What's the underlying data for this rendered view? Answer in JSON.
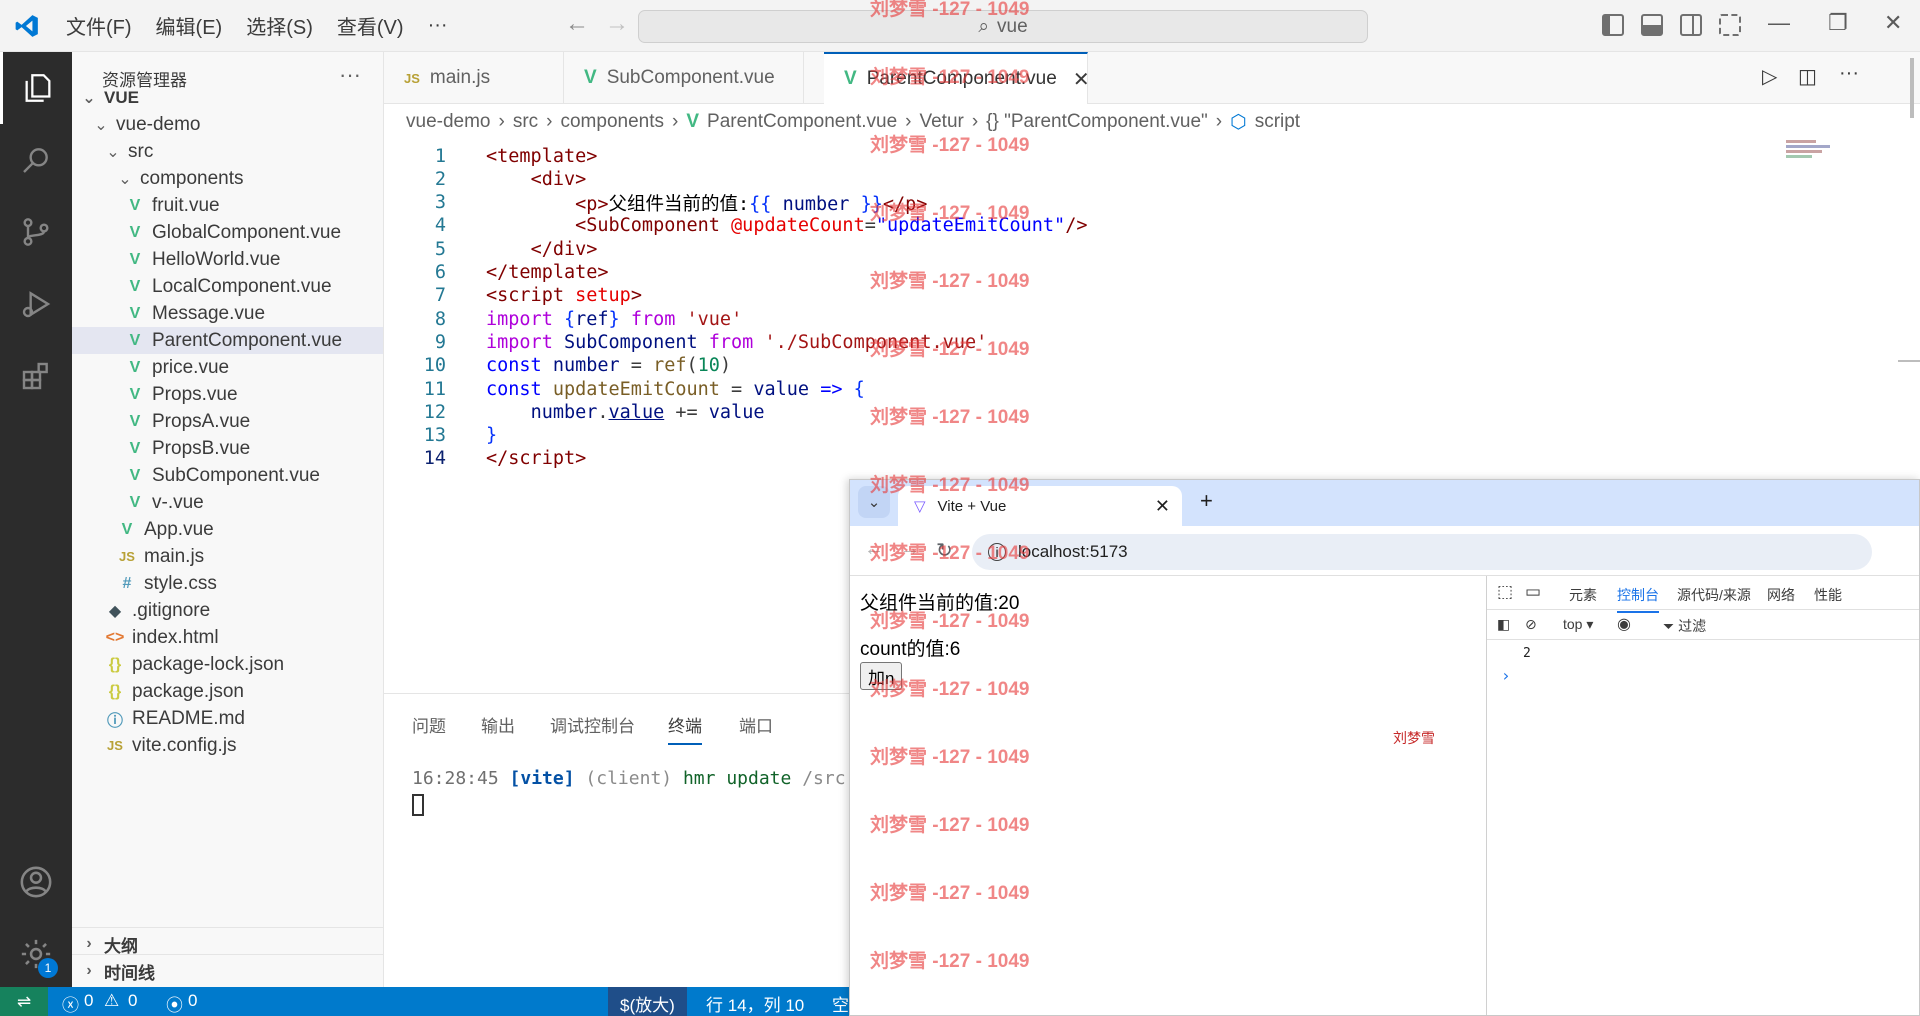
{
  "titlebar": {
    "menus": [
      "文件(F)",
      "编辑(E)",
      "选择(S)",
      "查看(V)",
      "···"
    ],
    "search": "vue"
  },
  "sidebar": {
    "title": "资源管理器",
    "more": "···",
    "rows": [
      {
        "label": "VUE",
        "icon": "chevron-down",
        "indent": 0,
        "bold": true
      },
      {
        "label": "vue-demo",
        "icon": "chevron-down",
        "indent": 1
      },
      {
        "label": "src",
        "icon": "chevron-down",
        "indent": 2
      },
      {
        "label": "components",
        "icon": "chevron-down",
        "indent": 3
      },
      {
        "label": "fruit.vue",
        "icon": "vue",
        "indent": 4
      },
      {
        "label": "GlobalComponent.vue",
        "icon": "vue",
        "indent": 4
      },
      {
        "label": "HelloWorld.vue",
        "icon": "vue",
        "indent": 4
      },
      {
        "label": "LocalComponent.vue",
        "icon": "vue",
        "indent": 4
      },
      {
        "label": "Message.vue",
        "icon": "vue",
        "indent": 4
      },
      {
        "label": "ParentComponent.vue",
        "icon": "vue",
        "indent": 4,
        "selected": true
      },
      {
        "label": "price.vue",
        "icon": "vue",
        "indent": 4
      },
      {
        "label": "Props.vue",
        "icon": "vue",
        "indent": 4
      },
      {
        "label": "PropsA.vue",
        "icon": "vue",
        "indent": 4
      },
      {
        "label": "PropsB.vue",
        "icon": "vue",
        "indent": 4
      },
      {
        "label": "SubComponent.vue",
        "icon": "vue",
        "indent": 4
      },
      {
        "label": "v-.vue",
        "icon": "vue",
        "indent": 4
      },
      {
        "label": "App.vue",
        "icon": "vue",
        "indent": 3
      },
      {
        "label": "main.js",
        "icon": "js",
        "indent": 3
      },
      {
        "label": "style.css",
        "icon": "css",
        "indent": 3
      },
      {
        "label": ".gitignore",
        "icon": "git",
        "indent": 2
      },
      {
        "label": "index.html",
        "icon": "html",
        "indent": 2
      },
      {
        "label": "package-lock.json",
        "icon": "json",
        "indent": 2
      },
      {
        "label": "package.json",
        "icon": "json",
        "indent": 2
      },
      {
        "label": "README.md",
        "icon": "info",
        "indent": 2
      },
      {
        "label": "vite.config.js",
        "icon": "js",
        "indent": 2
      }
    ],
    "outline": "大纲",
    "timeline": "时间线"
  },
  "tabs": [
    {
      "label": "main.js",
      "icon": "JS"
    },
    {
      "label": "SubComponent.vue",
      "icon": "vue"
    },
    {
      "label": "ParentComponent.vue",
      "icon": "vue",
      "active": true
    }
  ],
  "breadcrumb": [
    "vue-demo",
    "src",
    "components",
    "ParentComponent.vue",
    "Vetur",
    "{} \"ParentComponent.vue\"",
    "script"
  ],
  "code": [
    {
      "n": "1",
      "html": "<span class='tag'>&lt;template&gt;</span>"
    },
    {
      "n": "2",
      "html": "    <span class='tag'>&lt;div&gt;</span>"
    },
    {
      "n": "3",
      "html": "        <span class='tag'>&lt;p&gt;</span><span class='txt'>父组件当前的值:</span><span class='brace'>{{</span> <span class='var'>number</span> <span class='brace'>}}</span><span class='tag'>&lt;/p&gt;</span>"
    },
    {
      "n": "4",
      "html": "        <span class='tag'>&lt;SubComponent</span> <span class='attr'>@updateCount</span>=<span class='kw'>\"updateEmitCount\"</span><span class='tag'>/&gt;</span>"
    },
    {
      "n": "5",
      "html": "    <span class='tag'>&lt;/div&gt;</span>"
    },
    {
      "n": "6",
      "html": "<span class='tag'>&lt;/template&gt;</span>"
    },
    {
      "n": "7",
      "html": "<span class='tag'>&lt;script</span> <span class='attr'>setup</span><span class='tag'>&gt;</span>"
    },
    {
      "n": "8",
      "html": "<span class='kw2'>import</span> <span class='brace'>{</span><span class='var'>ref</span><span class='brace'>}</span> <span class='kw2'>from</span> <span class='str'>'vue'</span>"
    },
    {
      "n": "9",
      "html": "<span class='kw2'>import</span> <span class='var'>SubComponent</span> <span class='kw2'>from</span> <span class='str'>'./SubComponent.vue'</span>"
    },
    {
      "n": "10",
      "html": "<span class='kw'>const</span> <span class='var'>number</span> = <span class='fn'>ref</span>(<span class='num'>10</span>)"
    },
    {
      "n": "11",
      "html": "<span class='kw'>const</span> <span class='fn'>updateEmitCount</span> = <span class='var'>value</span> <span class='kw'>=&gt;</span> <span class='brace'>{</span>"
    },
    {
      "n": "12",
      "html": "    <span class='var'>number</span>.<span class='var' style='text-decoration:underline'>value</span> += <span class='var'>value</span>"
    },
    {
      "n": "13",
      "html": "<span class='brace'>}</span>"
    },
    {
      "n": "14",
      "html": "<span class='tag'>&lt;/script&gt;</span>",
      "current": true
    }
  ],
  "panel": {
    "tabs": [
      "问题",
      "输出",
      "调试控制台",
      "终端",
      "端口"
    ],
    "active": "终端",
    "terminal": {
      "time": "16:28:45",
      "vite": "[vite]",
      "client": "(client)",
      "msg": "hmr update",
      "path": "/src"
    }
  },
  "statusbar": {
    "errors": "0",
    "warnings": "0",
    "ports": "0",
    "zoom": "$(放大)",
    "position": "行 14，列 10",
    "spaces": "空"
  },
  "browser": {
    "tab_title": "Vite + Vue",
    "url": "localhost:5173",
    "parent_text": "父组件当前的值:20",
    "count_text": "count的值:6",
    "button": "加n",
    "signature": "刘梦雪"
  },
  "devtools": {
    "tabs": [
      "元素",
      "控制台",
      "源代码/来源",
      "网络",
      "性能"
    ],
    "active": "控制台",
    "context": "top",
    "filter": "过滤",
    "output": [
      "2"
    ]
  },
  "watermark": "刘梦雪 -127 - 1049",
  "colors": {
    "accent": "#005fb8",
    "statusbar": "#007acc",
    "vue_green": "#42b883",
    "watermark": "#e63c3c"
  }
}
